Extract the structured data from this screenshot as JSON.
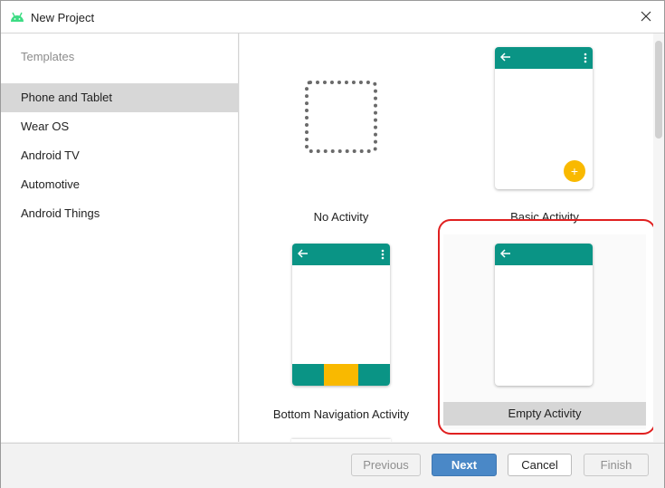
{
  "window": {
    "title": "New Project"
  },
  "sidebar": {
    "header": "Templates",
    "items": [
      {
        "label": "Phone and Tablet",
        "selected": true
      },
      {
        "label": "Wear OS"
      },
      {
        "label": "Android TV"
      },
      {
        "label": "Automotive"
      },
      {
        "label": "Android Things"
      }
    ]
  },
  "templates": {
    "no_activity": {
      "label": "No Activity"
    },
    "basic_activity": {
      "label": "Basic Activity"
    },
    "bottom_navigation_activity": {
      "label": "Bottom Navigation Activity"
    },
    "empty_activity": {
      "label": "Empty Activity",
      "selected": true
    }
  },
  "footer": {
    "previous": "Previous",
    "next": "Next",
    "cancel": "Cancel",
    "finish": "Finish"
  },
  "colors": {
    "appbar": "#0a9485",
    "accent": "#f9b900",
    "primary_button": "#4a88c7",
    "highlight": "#e02020"
  }
}
